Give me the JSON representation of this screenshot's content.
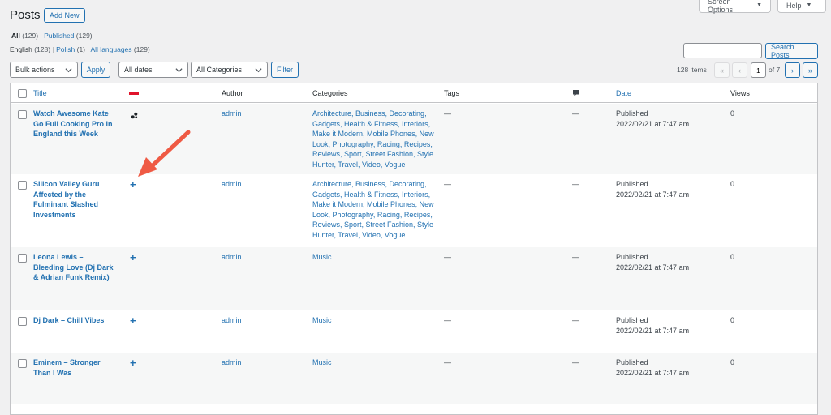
{
  "header": {
    "title": "Posts",
    "add_new": "Add New",
    "screen_options": "Screen Options",
    "help": "Help"
  },
  "status_filters": {
    "all": "All",
    "all_count": "(129)",
    "separator": "|",
    "published": "Published",
    "published_count": "(129)"
  },
  "language_filters": {
    "english": "English",
    "english_count": "(128)",
    "polish": "Polish",
    "polish_count": "(1)",
    "all_languages": "All languages",
    "all_languages_count": "(129)"
  },
  "search": {
    "value": "",
    "button": "Search Posts"
  },
  "toolbar": {
    "bulk_actions": "Bulk actions",
    "apply": "Apply",
    "dates": "All dates",
    "categories": "All Categories",
    "filter": "Filter"
  },
  "pagination": {
    "items": "128 items",
    "first": "«",
    "prev": "‹",
    "current_page": "1",
    "of_label": "of 7",
    "next": "›",
    "last": "»"
  },
  "columns": {
    "title": "Title",
    "author": "Author",
    "categories": "Categories",
    "tags": "Tags",
    "date": "Date",
    "views": "Views"
  },
  "language_flag_color": "#e0142b",
  "rows": [
    {
      "title_lines": [
        "Watch Awesome Kate",
        "Go Full Cooking Pro in",
        "England this Week"
      ],
      "lang_icon": "translation-link-icon",
      "author": "admin",
      "categories_lines": [
        "Architecture, Business, Decorating,",
        "Gadgets, Health & Fitness, Interiors,",
        "Make it Modern, Mobile Phones, New",
        "Look, Photography, Racing, Recipes,",
        "Reviews, Sport, Street Fashion, Style",
        "Hunter, Travel, Video, Vogue"
      ],
      "tags": "—",
      "comments": "—",
      "date_status": "Published",
      "date_value": "2022/02/21 at 7:47 am",
      "views": "0"
    },
    {
      "title_lines": [
        "Silicon Valley Guru",
        "Affected by the",
        "Fulminant Slashed",
        "Investments"
      ],
      "lang_icon": "add-translation-icon",
      "author": "admin",
      "categories_lines": [
        "Architecture, Business, Decorating,",
        "Gadgets, Health & Fitness, Interiors,",
        "Make it Modern, Mobile Phones, New",
        "Look, Photography, Racing, Recipes,",
        "Reviews, Sport, Street Fashion, Style",
        "Hunter, Travel, Video, Vogue"
      ],
      "tags": "—",
      "comments": "—",
      "date_status": "Published",
      "date_value": "2022/02/21 at 7:47 am",
      "views": "0"
    },
    {
      "title_lines": [
        "Leona Lewis –",
        "Bleeding Love (Dj Dark",
        "& Adrian Funk Remix)"
      ],
      "lang_icon": "add-translation-icon",
      "author": "admin",
      "categories_lines": [
        "Music"
      ],
      "tags": "—",
      "comments": "—",
      "date_status": "Published",
      "date_value": "2022/02/21 at 7:47 am",
      "views": "0"
    },
    {
      "title_lines": [
        "Dj Dark – Chill Vibes"
      ],
      "lang_icon": "add-translation-icon",
      "author": "admin",
      "categories_lines": [
        "Music"
      ],
      "tags": "—",
      "comments": "—",
      "date_status": "Published",
      "date_value": "2022/02/21 at 7:47 am",
      "views": "0"
    },
    {
      "title_lines": [
        "Eminem – Stronger",
        "Than I Was"
      ],
      "lang_icon": "add-translation-icon",
      "author": "admin",
      "categories_lines": [
        "Music"
      ],
      "tags": "—",
      "comments": "—",
      "date_status": "Published",
      "date_value": "2022/02/21 at 7:47 am",
      "views": "0"
    }
  ],
  "annotation": {
    "icon": "red-arrow-icon",
    "color": "#ef5a44"
  }
}
